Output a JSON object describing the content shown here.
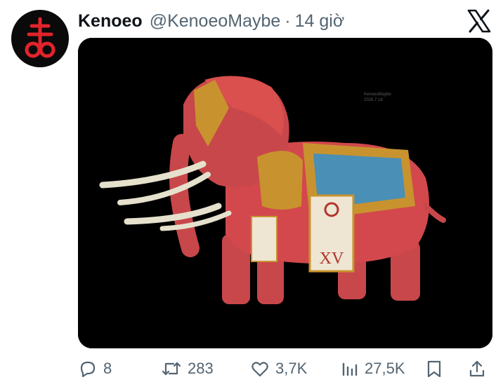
{
  "tweet": {
    "author_name": "Kenoeo",
    "author_handle": "@KenoeoMaybe",
    "separator": "·",
    "timestamp": "14 giờ",
    "media": {
      "signature_line1": "KenoeoMaybe",
      "signature_line2": "2026.7.18",
      "roman_numeral": "XV"
    }
  },
  "actions": {
    "replies": "8",
    "reposts": "283",
    "likes": "3,7K",
    "views": "27,5K"
  },
  "icons": [
    "leviathan-cross-icon",
    "x-logo-icon",
    "reply-icon",
    "repost-icon",
    "like-icon",
    "views-icon",
    "bookmark-icon",
    "share-icon"
  ],
  "colors": {
    "avatar_bg": "#0a0a0a",
    "avatar_symbol": "#e2232b",
    "text_primary": "#0f1419",
    "text_secondary": "#536471",
    "media_bg": "#000000"
  }
}
